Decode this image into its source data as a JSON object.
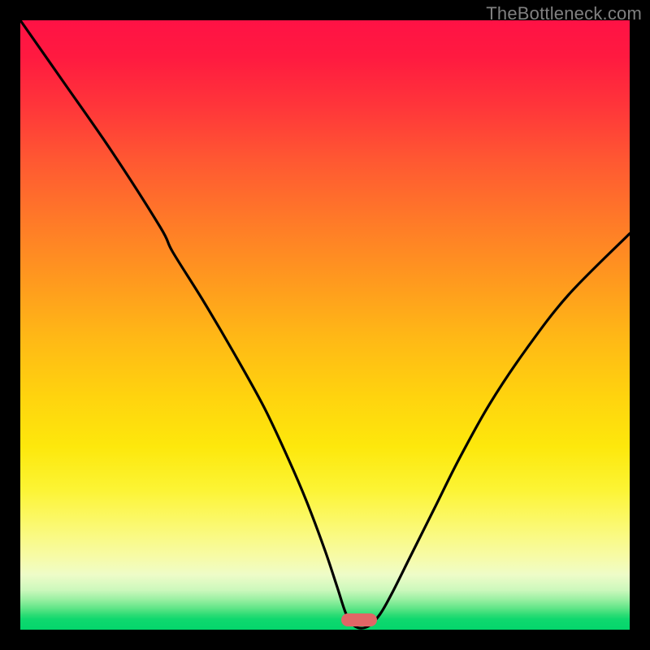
{
  "watermark": "TheBottleneck.com",
  "colors": {
    "frame": "#000000",
    "watermark_text": "#808080",
    "curve_stroke": "#000000",
    "marker_fill": "#e06666"
  },
  "chart_data": {
    "type": "line",
    "title": "",
    "xlabel": "",
    "ylabel": "",
    "xlim": [
      0,
      100
    ],
    "ylim": [
      0,
      100
    ],
    "grid": false,
    "series": [
      {
        "name": "bottleneck-curve",
        "x": [
          0,
          7,
          15,
          23,
          25,
          30,
          35,
          40,
          44,
          47,
          50,
          52,
          53.5,
          55,
          57,
          59,
          61,
          64,
          68,
          72,
          77,
          83,
          90,
          100
        ],
        "y": [
          100,
          90,
          78.5,
          66,
          62,
          54,
          45.5,
          36.5,
          28,
          21,
          13,
          7,
          2.5,
          0.5,
          0.5,
          2.5,
          6,
          12,
          20,
          28,
          37,
          46,
          55,
          65
        ]
      }
    ],
    "marker": {
      "x_start": 52.7,
      "x_end": 58.5,
      "y": 0.5,
      "height": 2.2
    },
    "gradient_stops": [
      {
        "pos": 0,
        "color": "#ff1245"
      },
      {
        "pos": 0.33,
        "color": "#ff7a28"
      },
      {
        "pos": 0.62,
        "color": "#ffd40e"
      },
      {
        "pos": 0.88,
        "color": "#eefcc8"
      },
      {
        "pos": 1.0,
        "color": "#04d66c"
      }
    ]
  }
}
